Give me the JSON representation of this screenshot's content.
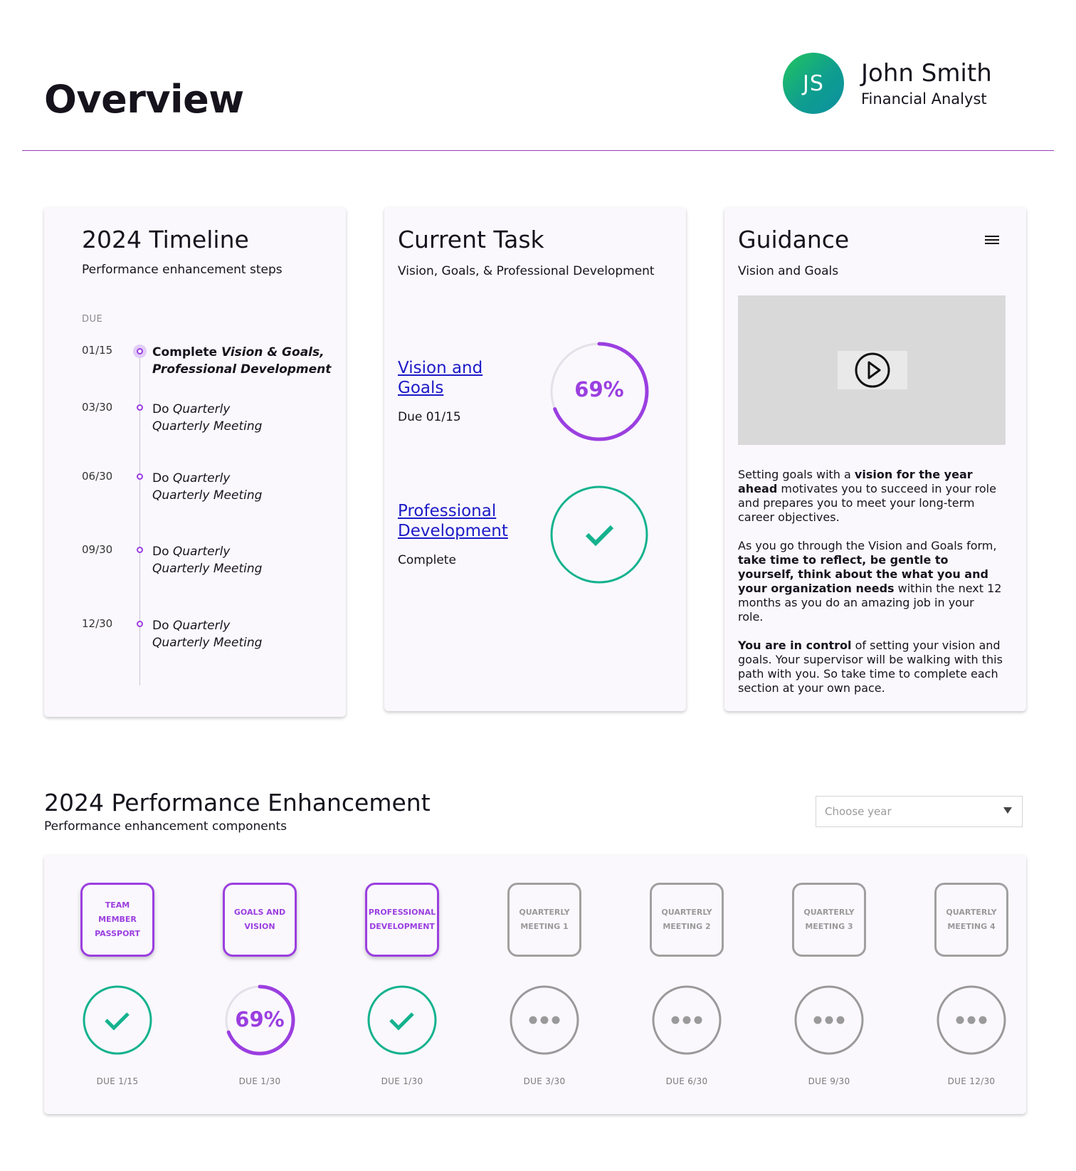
{
  "header": {
    "title": "Overview",
    "user": {
      "initials": "JS",
      "name": "John Smith",
      "role": "Financial Analyst"
    }
  },
  "timeline": {
    "title": "2024 Timeline",
    "subtitle": "Performance enhancement steps",
    "due_label": "DUE",
    "items": [
      {
        "date": "01/15",
        "line1_a": "Complete ",
        "line1_b": "Vision & Goals,",
        "line2": "Professional Development",
        "active": true
      },
      {
        "date": "03/30",
        "line1_a": "Do ",
        "line1_b": "Quarterly",
        "line2": "Quarterly Meeting",
        "active": false
      },
      {
        "date": "06/30",
        "line1_a": "Do ",
        "line1_b": "Quarterly",
        "line2": "Quarterly Meeting",
        "active": false
      },
      {
        "date": "09/30",
        "line1_a": "Do ",
        "line1_b": "Quarterly",
        "line2": "Quarterly Meeting",
        "active": false
      },
      {
        "date": "12/30",
        "line1_a": "Do ",
        "line1_b": "Quarterly",
        "line2": "Quarterly Meeting",
        "active": false
      }
    ]
  },
  "current_task": {
    "title": "Current Task",
    "subtitle": "Vision, Goals, & Professional Development",
    "tasks": [
      {
        "link_line1": "Vision and",
        "link_line2": "Goals",
        "meta": "Due 01/15",
        "progress": 0.69,
        "progress_label": "69%",
        "status": "in-progress"
      },
      {
        "link_line1": "Professional",
        "link_line2": "Development",
        "meta": "Complete",
        "status": "complete"
      }
    ]
  },
  "guidance": {
    "title": "Guidance",
    "subtitle": "Vision and Goals",
    "p1": {
      "a": "Setting goals with a ",
      "b": "vision for the year ahead",
      "c": " motivates you to succeed in your role and prepares you to meet your long-term career objectives."
    },
    "p2": {
      "a": "As you go through the Vision and Goals form, ",
      "b": "take time to reflect, be gentle to yourself, think about the what you and your organization needs",
      "c": " within the next 12 months as you do an amazing job in your role."
    },
    "p3": {
      "a": "You are in control",
      "b": " of setting your vision and goals. Your supervisor will be walking with this path with you. So take time to complete each section at your own pace."
    }
  },
  "performance": {
    "title": "2024 Performance Enhancement",
    "subtitle": "Performance enhancement components",
    "year_placeholder": "Choose year",
    "components": [
      {
        "label": "TEAM MEMBER PASSPORT",
        "status": "complete",
        "due": "DUE 1/15",
        "active": true
      },
      {
        "label": "GOALS AND VISION",
        "status": "in-progress",
        "progress": 0.69,
        "progress_label": "69%",
        "due": "DUE 1/30",
        "active": true
      },
      {
        "label": "PROFESSIONAL DEVELOPMENT",
        "status": "complete",
        "due": "DUE 1/30",
        "active": true
      },
      {
        "label": "QUARTERLY MEETING 1",
        "status": "pending",
        "due": "DUE 3/30",
        "active": false
      },
      {
        "label": "QUARTERLY MEETING 2",
        "status": "pending",
        "due": "DUE 6/30",
        "active": false
      },
      {
        "label": "QUARTERLY MEETING 3",
        "status": "pending",
        "due": "DUE 9/30",
        "active": false
      },
      {
        "label": "QUARTERLY MEETING 4",
        "status": "pending",
        "due": "DUE 12/30",
        "active": false
      }
    ]
  },
  "colors": {
    "purple": "#9b3fe0",
    "teal": "#14b28e",
    "gray": "#9a9a9a",
    "link": "#1d1ac7"
  }
}
